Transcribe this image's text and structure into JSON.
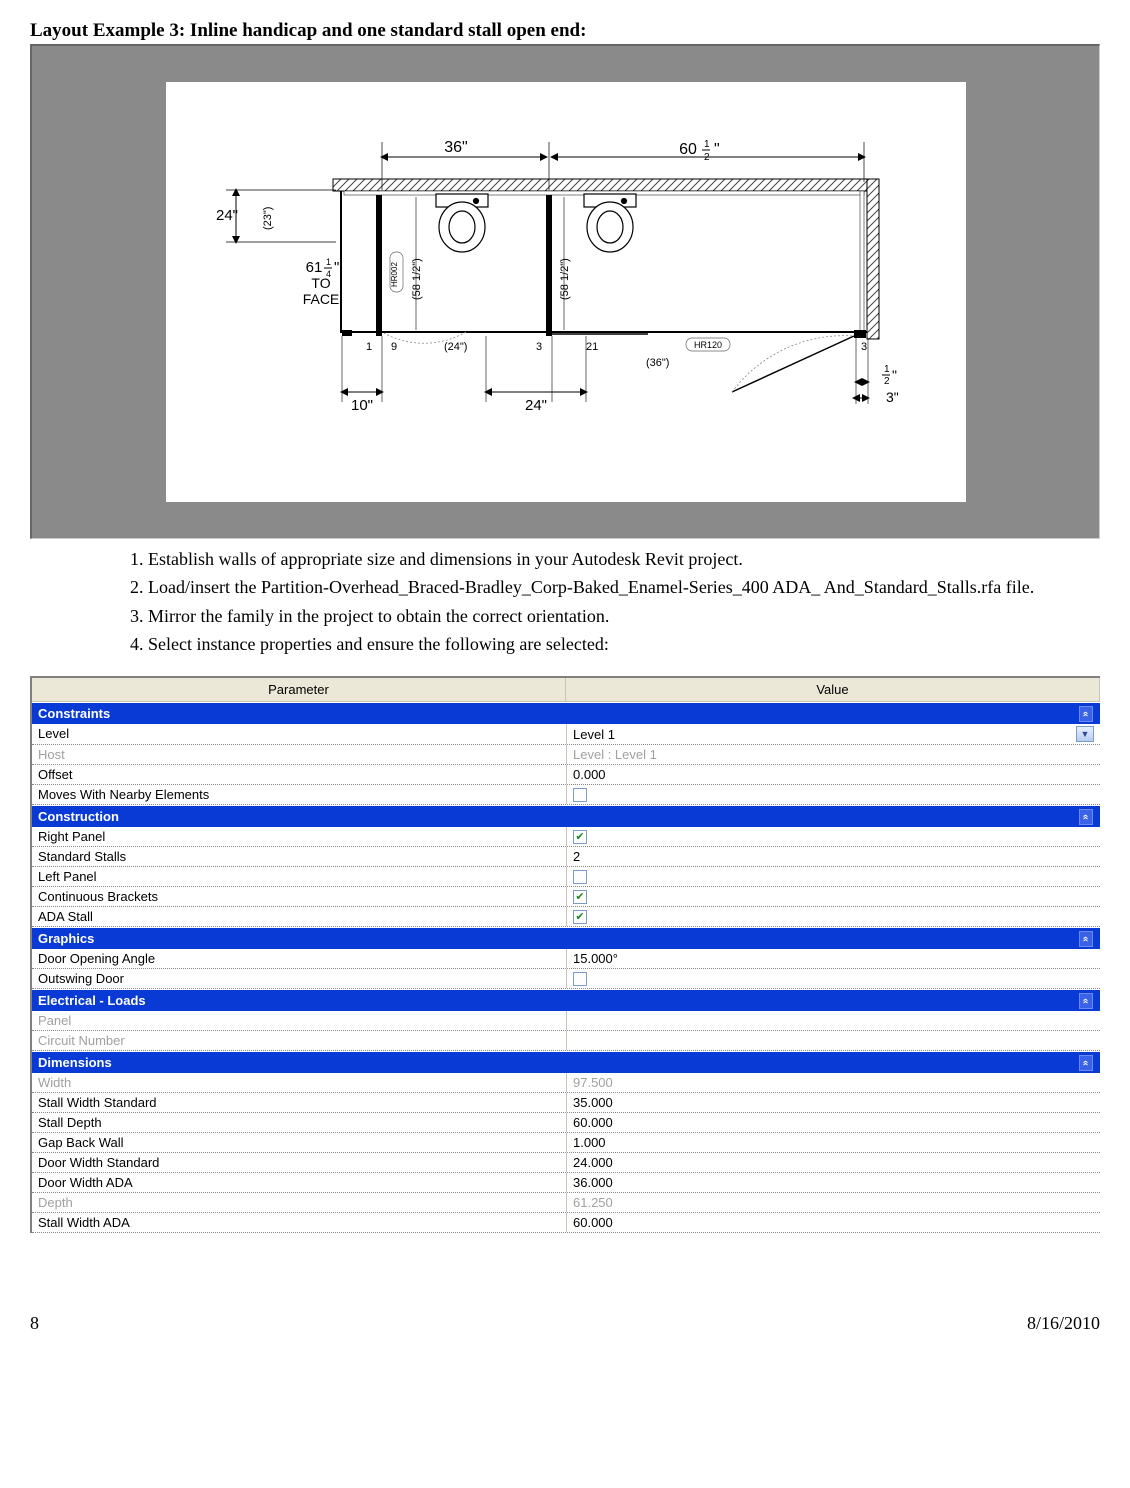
{
  "title": "Layout Example 3: Inline handicap and one standard stall open end:",
  "figure": {
    "top_dim_1": "36\"",
    "top_dim_2_whole": "60",
    "top_dim_2_frac_top": "1",
    "top_dim_2_frac_bot": "2",
    "top_dim_2_suffix": "\"",
    "left_dim": "24\"",
    "left_vert_label": "(23\")",
    "mid_label_whole": "61",
    "mid_label_frac_top": "1",
    "mid_label_frac_bot": "4",
    "mid_label_suffix": "\"",
    "mid_label_line2": "TO",
    "mid_label_line3": "FACE",
    "vert_label_1": "HR002",
    "vert_label_2": "(58 1/2\")",
    "vert_label_3": "(58 1/2\")",
    "row_n1": "1",
    "row_n9": "9",
    "row_24": "(24\")",
    "row_n3": "3",
    "row_n21": "21",
    "row_hr120": "HR120",
    "row_36": "(36\")",
    "row_n3b": "3",
    "bottom_10": "10\"",
    "bottom_24": "24\"",
    "bottom_half_top": "1",
    "bottom_half_bot": "2",
    "bottom_half_suffix": "\"",
    "bottom_3": "3\""
  },
  "steps": [
    "Establish walls of appropriate size and dimensions in your Autodesk Revit project.",
    "Load/insert the Partition-Overhead_Braced-Bradley_Corp-Baked_Enamel-Series_400 ADA_ And_Standard_Stalls.rfa file.",
    "Mirror the family in the project to obtain the correct orientation.",
    "Select instance properties and ensure the following are selected:"
  ],
  "table": {
    "head_param": "Parameter",
    "head_value": "Value",
    "groups": [
      {
        "name": "Constraints",
        "rows": [
          {
            "name": "Level",
            "value": "Level 1",
            "type": "dropdown"
          },
          {
            "name": "Host",
            "value": "Level : Level 1",
            "type": "text",
            "disabled": true
          },
          {
            "name": "Offset",
            "value": "0.000",
            "type": "text"
          },
          {
            "name": "Moves With Nearby Elements",
            "value": "",
            "type": "checkbox",
            "checked": false
          }
        ]
      },
      {
        "name": "Construction",
        "rows": [
          {
            "name": "Right Panel",
            "value": "",
            "type": "checkbox",
            "checked": true
          },
          {
            "name": "Standard Stalls",
            "value": "2",
            "type": "text"
          },
          {
            "name": "Left Panel",
            "value": "",
            "type": "checkbox",
            "checked": false
          },
          {
            "name": "Continuous Brackets",
            "value": "",
            "type": "checkbox",
            "checked": true
          },
          {
            "name": "ADA Stall",
            "value": "",
            "type": "checkbox",
            "checked": true
          }
        ]
      },
      {
        "name": "Graphics",
        "rows": [
          {
            "name": "Door Opening Angle",
            "value": "15.000°",
            "type": "text"
          },
          {
            "name": "Outswing Door",
            "value": "",
            "type": "checkbox",
            "checked": false
          }
        ]
      },
      {
        "name": "Electrical - Loads",
        "rows": [
          {
            "name": "Panel",
            "value": "",
            "type": "text",
            "disabled": true
          },
          {
            "name": "Circuit Number",
            "value": "",
            "type": "text",
            "disabled": true
          }
        ]
      },
      {
        "name": "Dimensions",
        "rows": [
          {
            "name": "Width",
            "value": "97.500",
            "type": "text",
            "disabled": true
          },
          {
            "name": "Stall Width Standard",
            "value": "35.000",
            "type": "text"
          },
          {
            "name": "Stall Depth",
            "value": "60.000",
            "type": "text"
          },
          {
            "name": "Gap Back Wall",
            "value": "1.000",
            "type": "text"
          },
          {
            "name": "Door Width Standard",
            "value": "24.000",
            "type": "text"
          },
          {
            "name": "Door Width ADA",
            "value": "36.000",
            "type": "text"
          },
          {
            "name": "Depth",
            "value": "61.250",
            "type": "text",
            "disabled": true
          },
          {
            "name": "Stall Width ADA",
            "value": "60.000",
            "type": "text"
          }
        ]
      }
    ]
  },
  "footer": {
    "page": "8",
    "date": "8/16/2010"
  }
}
